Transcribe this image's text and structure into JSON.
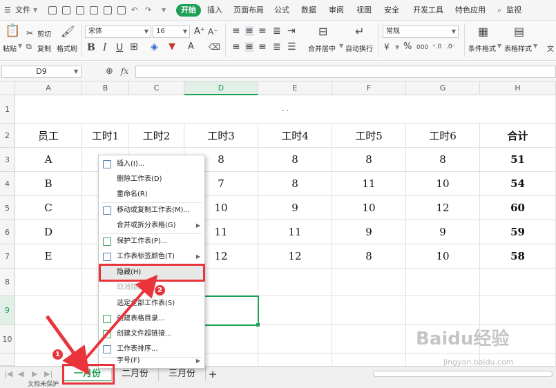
{
  "menubar": {
    "file_label": "文件",
    "tabs": [
      "开始",
      "插入",
      "页面布局",
      "公式",
      "数据",
      "审阅",
      "视图",
      "安全",
      "开发工具",
      "特色应用"
    ],
    "search_label": "监视"
  },
  "ribbon": {
    "paste": "粘贴",
    "cut": "剪切",
    "copy": "复制",
    "format_painter": "格式刷",
    "font_name": "宋体",
    "font_size": "16",
    "bold": "B",
    "italic": "I",
    "underline": "U",
    "merge_center": "合并居中",
    "wrap_text": "自动换行",
    "number_format": "常规",
    "percent": "%",
    "thousands": "000",
    "conditional_format": "条件格式",
    "table_style": "表格样式",
    "text_tool": "文"
  },
  "formula_bar": {
    "name_box": "D9",
    "fx": "fx"
  },
  "grid": {
    "columns": [
      "A",
      "B",
      "C",
      "D",
      "E",
      "F",
      "G",
      "H"
    ],
    "selected_column": "D",
    "rows": [
      "1",
      "2",
      "3",
      "4",
      "5",
      "6",
      "7",
      "8",
      "9",
      "10"
    ],
    "selected_row": "9",
    "title_text": ". .",
    "header_row": [
      "员工",
      "工时1",
      "工时2",
      "工时3",
      "工时4",
      "工时5",
      "工时6",
      "合计"
    ],
    "data_rows": [
      {
        "name": "A",
        "b": "",
        "c": "",
        "d": "8",
        "e": "8",
        "f": "8",
        "g": "8",
        "h": "51"
      },
      {
        "name": "B",
        "b": "",
        "c": "",
        "d": "7",
        "e": "8",
        "f": "11",
        "g": "10",
        "h": "54"
      },
      {
        "name": "C",
        "b": "",
        "c": "",
        "d": "10",
        "e": "9",
        "f": "10",
        "g": "12",
        "h": "60"
      },
      {
        "name": "D",
        "b": "",
        "c": "",
        "d": "11",
        "e": "11",
        "f": "9",
        "g": "9",
        "h": "59"
      },
      {
        "name": "E",
        "b": "",
        "c": "",
        "d": "12",
        "e": "12",
        "f": "8",
        "g": "10",
        "h": "58"
      }
    ]
  },
  "context_menu": {
    "items": [
      {
        "label": "插入(I)...",
        "icon": "insert-sheet-icon",
        "submenu": false,
        "disabled": false
      },
      {
        "label": "删除工作表(D)",
        "icon": "",
        "submenu": false,
        "disabled": false
      },
      {
        "label": "重命名(R)",
        "icon": "",
        "submenu": false,
        "disabled": false
      },
      {
        "label": "移动或复制工作表(M)...",
        "icon": "move-copy-icon",
        "submenu": false,
        "disabled": false
      },
      {
        "label": "合并或拆分表格(G)",
        "icon": "",
        "submenu": true,
        "disabled": false
      },
      {
        "label": "保护工作表(P)...",
        "icon": "protect-sheet-icon",
        "submenu": false,
        "disabled": false
      },
      {
        "label": "工作表标签颜色(T)",
        "icon": "tab-color-icon",
        "submenu": true,
        "disabled": false
      },
      {
        "label": "隐藏(H)",
        "icon": "",
        "submenu": false,
        "disabled": false
      },
      {
        "label": "取消隐藏(U)...",
        "icon": "",
        "submenu": false,
        "disabled": true
      },
      {
        "label": "选定全部工作表(S)",
        "icon": "",
        "submenu": false,
        "disabled": false
      },
      {
        "label": "创建表格目录...",
        "icon": "table-directory-icon",
        "submenu": false,
        "disabled": false
      },
      {
        "label": "创建文件超链接...",
        "icon": "hyperlink-icon",
        "submenu": false,
        "disabled": false
      },
      {
        "label": "工作表排序...",
        "icon": "sort-sheet-icon",
        "submenu": false,
        "disabled": false
      },
      {
        "label": "字号(F)",
        "icon": "",
        "submenu": true,
        "disabled": false
      }
    ]
  },
  "sheet_tabs": {
    "tabs": [
      "一月份",
      "二月份",
      "三月份"
    ],
    "active": "一月份",
    "add": "+"
  },
  "status": {
    "text": "文档未保护"
  },
  "annotations": {
    "badge1": "1",
    "badge2": "2",
    "accent": "#e8343a"
  },
  "watermark": {
    "brand": "Baidu经验",
    "url": "jingyan.baidu.com"
  },
  "colors": {
    "brand_green": "#1e9f53"
  }
}
